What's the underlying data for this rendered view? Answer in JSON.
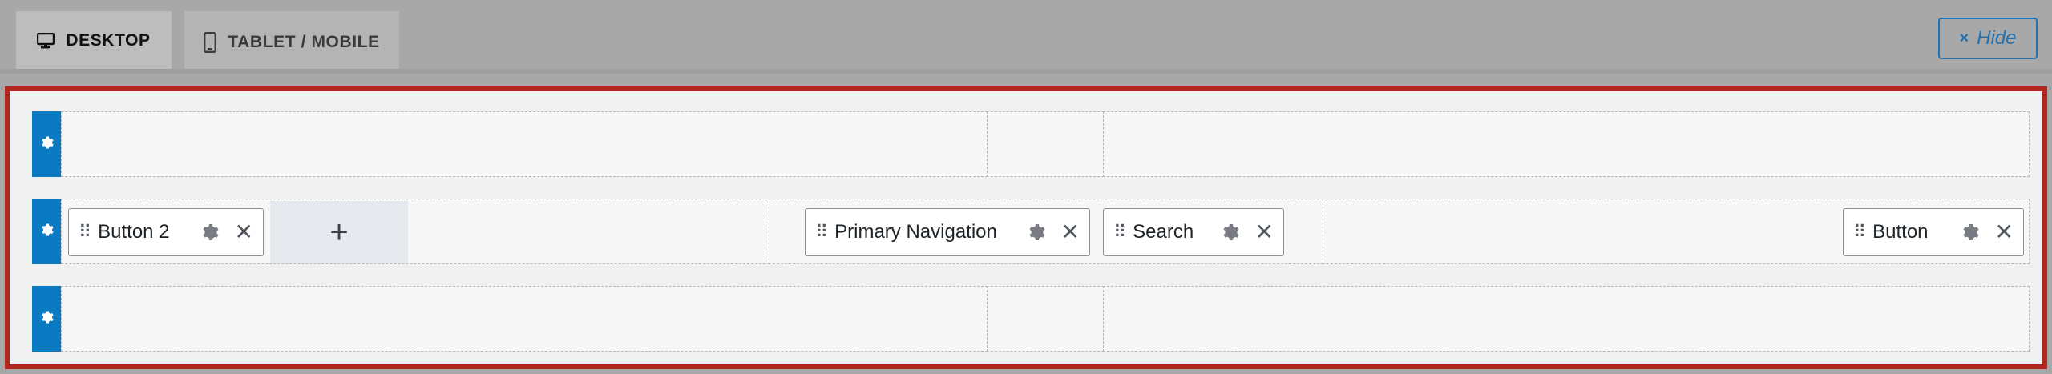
{
  "tabs": {
    "desktop": "DESKTOP",
    "mobile": "TABLET / MOBILE",
    "hide": "Hide",
    "hide_icon": "×"
  },
  "rows": {
    "main": {
      "left_items": [
        {
          "label": "Button 2"
        }
      ],
      "add_symbol": "+",
      "center_items": [
        {
          "label": "Primary Navigation"
        },
        {
          "label": "Search"
        }
      ],
      "right_items": [
        {
          "label": "Button"
        }
      ]
    }
  },
  "icons": {
    "grip": "⠿",
    "close": "✕"
  },
  "colors": {
    "accent": "#2271b1",
    "row_handle": "#0a7ac2",
    "panel_border": "#b3261e"
  }
}
